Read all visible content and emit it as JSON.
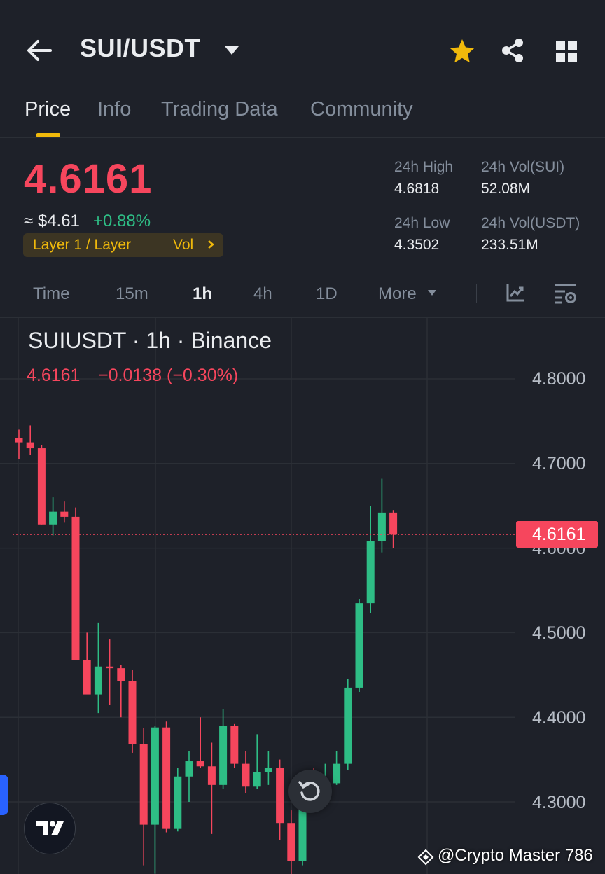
{
  "header": {
    "pair": "SUI/USDT",
    "icons": [
      "back-arrow-icon",
      "caret-down-icon",
      "star-icon",
      "share-icon",
      "grid-icon"
    ],
    "star_color": "#f0b90b"
  },
  "tabs": [
    {
      "label": "Price",
      "active": true
    },
    {
      "label": "Info",
      "active": false
    },
    {
      "label": "Trading Data",
      "active": false
    },
    {
      "label": "Community",
      "active": false
    }
  ],
  "ticker": {
    "last_price": "4.6161",
    "usd_price": "≈ $4.61",
    "change_pct": "+0.88%",
    "tag": "Layer 1 / Layer",
    "tag_vol": "Vol",
    "high_label": "24h High",
    "high_value": "4.6818",
    "low_label": "24h Low",
    "low_value": "4.3502",
    "vol_base_label": "24h Vol(SUI)",
    "vol_base_value": "52.08M",
    "vol_quote_label": "24h Vol(USDT)",
    "vol_quote_value": "233.51M",
    "down_color": "#f6465d",
    "up_color": "#2ebd85",
    "accent": "#f0b90b"
  },
  "intervals": [
    {
      "label": "Time",
      "active": false
    },
    {
      "label": "15m",
      "active": false
    },
    {
      "label": "1h",
      "active": true
    },
    {
      "label": "4h",
      "active": false
    },
    {
      "label": "1D",
      "active": false
    },
    {
      "label": "More",
      "active": false
    }
  ],
  "chart": {
    "title": "SUIUSDT · 1h · Binance",
    "ohlc_price": "4.6161",
    "ohlc_change": "−0.0138 (−0.30%)",
    "y_ticks": [
      "4.8000",
      "4.7000",
      "4.6000",
      "4.5000",
      "4.4000",
      "4.3000"
    ],
    "last_price_badge": "4.6161",
    "watermark": "@Crypto Master 786",
    "logo_text": "TV"
  },
  "chart_data": {
    "type": "candlestick",
    "title": "SUIUSDT · 1h · Binance",
    "ylim": [
      4.26,
      4.8
    ],
    "y_ticks": [
      4.8,
      4.7,
      4.6,
      4.5,
      4.4,
      4.3
    ],
    "last_price": 4.6161,
    "up_color": "#2ebd85",
    "down_color": "#f6465d",
    "candles": [
      {
        "o": 4.73,
        "h": 4.74,
        "l": 4.705,
        "c": 4.725
      },
      {
        "o": 4.725,
        "h": 4.745,
        "l": 4.71,
        "c": 4.718
      },
      {
        "o": 4.718,
        "h": 4.722,
        "l": 4.628,
        "c": 4.628
      },
      {
        "o": 4.628,
        "h": 4.66,
        "l": 4.615,
        "c": 4.643
      },
      {
        "o": 4.643,
        "h": 4.655,
        "l": 4.63,
        "c": 4.637
      },
      {
        "o": 4.637,
        "h": 4.648,
        "l": 4.48,
        "c": 4.468
      },
      {
        "o": 4.468,
        "h": 4.5,
        "l": 4.452,
        "c": 4.427
      },
      {
        "o": 4.427,
        "h": 4.512,
        "l": 4.405,
        "c": 4.46
      },
      {
        "o": 4.46,
        "h": 4.492,
        "l": 4.415,
        "c": 4.458
      },
      {
        "o": 4.458,
        "h": 4.462,
        "l": 4.4,
        "c": 4.443
      },
      {
        "o": 4.443,
        "h": 4.456,
        "l": 4.358,
        "c": 4.368
      },
      {
        "o": 4.368,
        "h": 4.387,
        "l": 4.225,
        "c": 4.273
      },
      {
        "o": 4.273,
        "h": 4.39,
        "l": 4.215,
        "c": 4.388
      },
      {
        "o": 4.388,
        "h": 4.395,
        "l": 4.264,
        "c": 4.268
      },
      {
        "o": 4.268,
        "h": 4.34,
        "l": 4.265,
        "c": 4.33
      },
      {
        "o": 4.33,
        "h": 4.36,
        "l": 4.3,
        "c": 4.348
      },
      {
        "o": 4.348,
        "h": 4.4,
        "l": 4.34,
        "c": 4.342
      },
      {
        "o": 4.342,
        "h": 4.37,
        "l": 4.262,
        "c": 4.32
      },
      {
        "o": 4.32,
        "h": 4.41,
        "l": 4.315,
        "c": 4.39
      },
      {
        "o": 4.39,
        "h": 4.392,
        "l": 4.34,
        "c": 4.345
      },
      {
        "o": 4.345,
        "h": 4.36,
        "l": 4.31,
        "c": 4.318
      },
      {
        "o": 4.318,
        "h": 4.38,
        "l": 4.315,
        "c": 4.335
      },
      {
        "o": 4.335,
        "h": 4.36,
        "l": 4.32,
        "c": 4.34
      },
      {
        "o": 4.34,
        "h": 4.35,
        "l": 4.255,
        "c": 4.275
      },
      {
        "o": 4.275,
        "h": 4.29,
        "l": 4.195,
        "c": 4.23
      },
      {
        "o": 4.23,
        "h": 4.33,
        "l": 4.225,
        "c": 4.326
      },
      {
        "o": 4.326,
        "h": 4.34,
        "l": 4.315,
        "c": 4.32
      },
      {
        "o": 4.32,
        "h": 4.345,
        "l": 4.315,
        "c": 4.322
      },
      {
        "o": 4.322,
        "h": 4.36,
        "l": 4.32,
        "c": 4.345
      },
      {
        "o": 4.345,
        "h": 4.445,
        "l": 4.338,
        "c": 4.435
      },
      {
        "o": 4.435,
        "h": 4.54,
        "l": 4.43,
        "c": 4.535
      },
      {
        "o": 4.535,
        "h": 4.65,
        "l": 4.523,
        "c": 4.608
      },
      {
        "o": 4.608,
        "h": 4.682,
        "l": 4.595,
        "c": 4.642
      },
      {
        "o": 4.642,
        "h": 4.645,
        "l": 4.6,
        "c": 4.616
      }
    ]
  }
}
